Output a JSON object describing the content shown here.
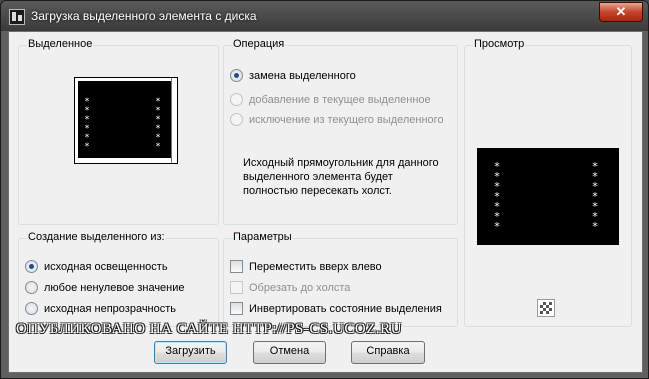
{
  "window": {
    "title": "Загрузка выделенного элемента с диска",
    "close_label": "✕"
  },
  "selection_group": {
    "label": "Выделенное",
    "star_glyphs": "*\n*\n*\n*\n*\n*"
  },
  "operation_group": {
    "label": "Операция",
    "options": [
      {
        "label": "замена выделенного",
        "checked": true,
        "enabled": true
      },
      {
        "label": "добавление в текущее выделенное",
        "checked": false,
        "enabled": false
      },
      {
        "label": "исключение из текущего выделенного",
        "checked": false,
        "enabled": false
      }
    ],
    "info_text": "Исходный прямоугольник для данного выделенного элемента будет полностью пересекать холст."
  },
  "preview_group": {
    "label": "Просмотр",
    "star_glyphs": "*\n*\n*\n*\n*\n*\n*"
  },
  "create_from_group": {
    "label": "Создание выделенного из:",
    "options": [
      {
        "label": "исходная освещенность",
        "checked": true
      },
      {
        "label": "любое ненулевое значение",
        "checked": false
      },
      {
        "label": "исходная непрозрачность",
        "checked": false
      }
    ]
  },
  "parameters_group": {
    "label": "Параметры",
    "options": [
      {
        "label": "Переместить вверх влево",
        "checked": false,
        "enabled": true
      },
      {
        "label": "Обрезать до холста",
        "checked": false,
        "enabled": false
      },
      {
        "label": "Инвертировать состояние выделения",
        "checked": false,
        "enabled": true
      }
    ]
  },
  "watermark_text": "ОПУБЛИКОВАНО   НА САЙТЕ   HTTP://PS-CS.UCOZ.RU",
  "buttons": {
    "load": "Загрузить",
    "cancel": "Отмена",
    "help": "Справка"
  },
  "icons": {
    "app": "app-icon",
    "close": "close-icon",
    "transparency_toggle": "checkerboard-icon"
  }
}
